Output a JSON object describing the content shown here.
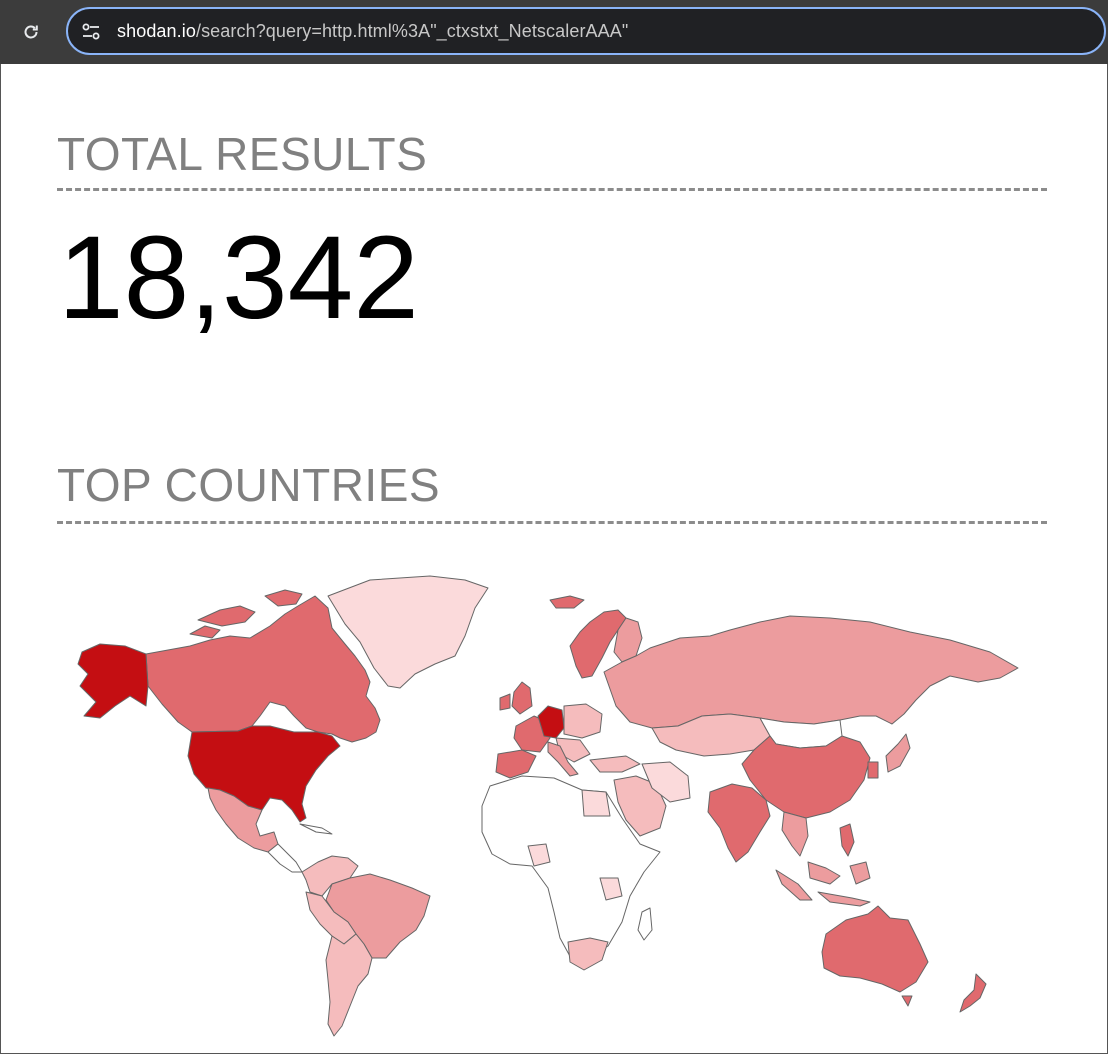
{
  "browser": {
    "url_host": "shodan.io",
    "url_rest": "/search?query=http.html%3A\"_ctxstxt_NetscalerAAA\""
  },
  "total_results": {
    "title": "TOTAL RESULTS",
    "value": "18,342"
  },
  "top_countries": {
    "title": "TOP COUNTRIES"
  },
  "colors": {
    "highest": "#c40e12",
    "high": "#e06a6e",
    "medium": "#ec9c9e",
    "low": "#f5bcbd",
    "lowest": "#fbdadb",
    "none": "#ffffff"
  },
  "icons": {
    "reload": "reload-icon",
    "site_settings": "tune-icon"
  }
}
